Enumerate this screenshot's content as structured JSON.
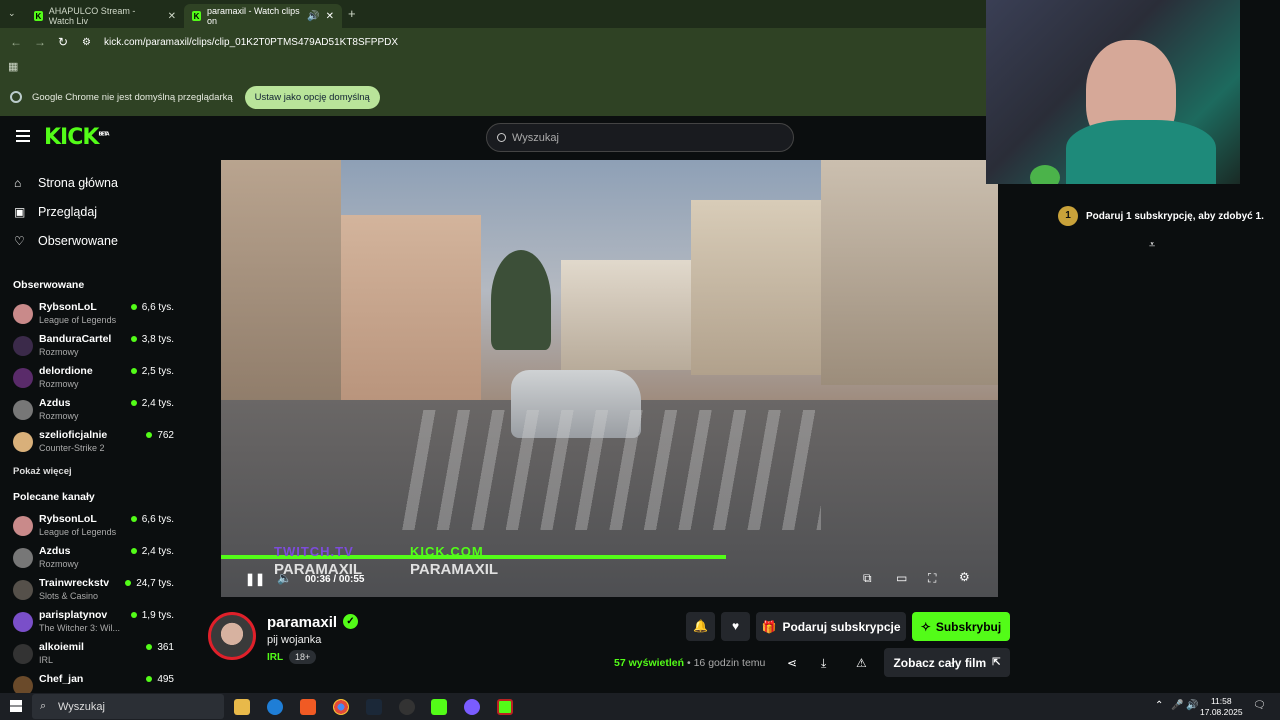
{
  "browser": {
    "tabs": [
      {
        "title": "AHAPULCO Stream - Watch Liv",
        "active": false
      },
      {
        "title": "paramaxil - Watch clips on",
        "active": true
      }
    ],
    "new_tab": "+",
    "url": "kick.com/paramaxil/clips/clip_01K2T0PTMS479AD51KT8SFPPDX",
    "infobar": {
      "message": "Google Chrome nie jest domyślną przeglądarką",
      "button": "Ustaw jako opcję domyślną"
    }
  },
  "kick": {
    "logo": "KICK",
    "logo_sup": "BETA",
    "search_placeholder": "Wyszukaj",
    "nav": [
      {
        "label": "Strona główna",
        "icon": "home-icon"
      },
      {
        "label": "Przeglądaj",
        "icon": "browse-icon"
      },
      {
        "label": "Obserwowane",
        "icon": "heart-icon"
      }
    ],
    "followed_title": "Obserwowane",
    "followed": [
      {
        "name": "RybsonLoL",
        "category": "League of Legends",
        "viewers": "6,6 tys.",
        "color": "#c98a8a"
      },
      {
        "name": "BanduraCartel",
        "category": "Rozmowy",
        "viewers": "3,8 tys.",
        "color": "#3b2a4a"
      },
      {
        "name": "delordione",
        "category": "Rozmowy",
        "viewers": "2,5 tys.",
        "color": "#5a2b6a"
      },
      {
        "name": "Azdus",
        "category": "Rozmowy",
        "viewers": "2,4 tys.",
        "color": "#777777"
      },
      {
        "name": "szelioficjalnie",
        "category": "Counter-Strike 2",
        "viewers": "762",
        "color": "#d9b07a"
      }
    ],
    "show_more": "Pokaż więcej",
    "recommended_title": "Polecane kanały",
    "recommended": [
      {
        "name": "RybsonLoL",
        "category": "League of Legends",
        "viewers": "6,6 tys.",
        "color": "#c98a8a"
      },
      {
        "name": "Azdus",
        "category": "Rozmowy",
        "viewers": "2,4 tys.",
        "color": "#777777"
      },
      {
        "name": "Trainwreckstv",
        "category": "Slots & Casino",
        "viewers": "24,7 tys.",
        "color": "#55504a"
      },
      {
        "name": "parisplatynov",
        "category": "The Witcher 3: Wil...",
        "viewers": "1,9 tys.",
        "color": "#7a4fc9"
      },
      {
        "name": "alkoiemil",
        "category": "IRL",
        "viewers": "361",
        "color": "#333333"
      },
      {
        "name": "Chef_jan",
        "category": "",
        "viewers": "495",
        "color": "#6a4a2a"
      }
    ],
    "player": {
      "time": "00:36 / 00:55",
      "progress": 0.65,
      "watermark_twitch": "TWITCH.TV",
      "watermark_twitch_name": "PARAMAXIL",
      "watermark_kick": "KICK.COM",
      "watermark_kick_name": "PARAMAXIL"
    },
    "clip": {
      "channel": "paramaxil",
      "verified": "✓",
      "title": "pij wojanka",
      "category": "IRL",
      "age": "18+",
      "views_count": "57",
      "views_label": "wyświetleń",
      "separator": "•",
      "posted": "16 godzin temu",
      "gift_button": "Podaruj subskrypcje",
      "subscribe_button": "Subskrybuj",
      "full_film_button": "Zobacz cały film"
    },
    "right_panel": {
      "gift_badge": "1",
      "gift_text": "Podaruj 1 subskrypcję, aby zdobyć 1."
    }
  },
  "taskbar": {
    "search": "Wyszukaj",
    "time": "11:58",
    "date": "17.08.2025"
  }
}
